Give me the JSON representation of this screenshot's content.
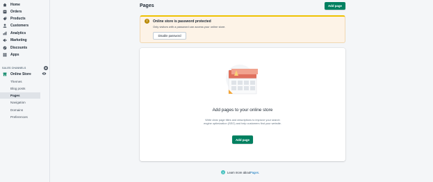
{
  "sidebar": {
    "nav": [
      {
        "label": "Home",
        "icon": "home-icon"
      },
      {
        "label": "Orders",
        "icon": "orders-icon"
      },
      {
        "label": "Products",
        "icon": "products-icon"
      },
      {
        "label": "Customers",
        "icon": "customers-icon"
      },
      {
        "label": "Analytics",
        "icon": "analytics-icon"
      },
      {
        "label": "Marketing",
        "icon": "marketing-icon"
      },
      {
        "label": "Discounts",
        "icon": "discounts-icon"
      },
      {
        "label": "Apps",
        "icon": "apps-icon"
      }
    ],
    "sales_channels_heading": "SALES CHANNELS",
    "online_store_label": "Online Store",
    "sub_items": [
      "Themes",
      "Blog posts",
      "Pages",
      "Navigation",
      "Domains",
      "Preferences"
    ],
    "active_sub_item": "Pages"
  },
  "header": {
    "title": "Pages",
    "add_page_label": "Add page"
  },
  "banner": {
    "icon_glyph": "!",
    "title": "Online store is password protected",
    "text": "Only visitors with a password can access your online store.",
    "button_label": "Disable password"
  },
  "empty_state": {
    "heading": "Add pages to your online store",
    "description": "Write clear page titles and descriptions to improve your search engine optimization (SEO) and help customers find your website.",
    "button_label": "Add page"
  },
  "footer": {
    "info_glyph": "?",
    "learn_prefix": "Learn more about ",
    "learn_link": "Pages",
    "learn_suffix": "."
  },
  "colors": {
    "primary": "#008060",
    "banner_bg": "#fdf3e7",
    "banner_accent": "#eec200",
    "link": "#006fbb"
  }
}
